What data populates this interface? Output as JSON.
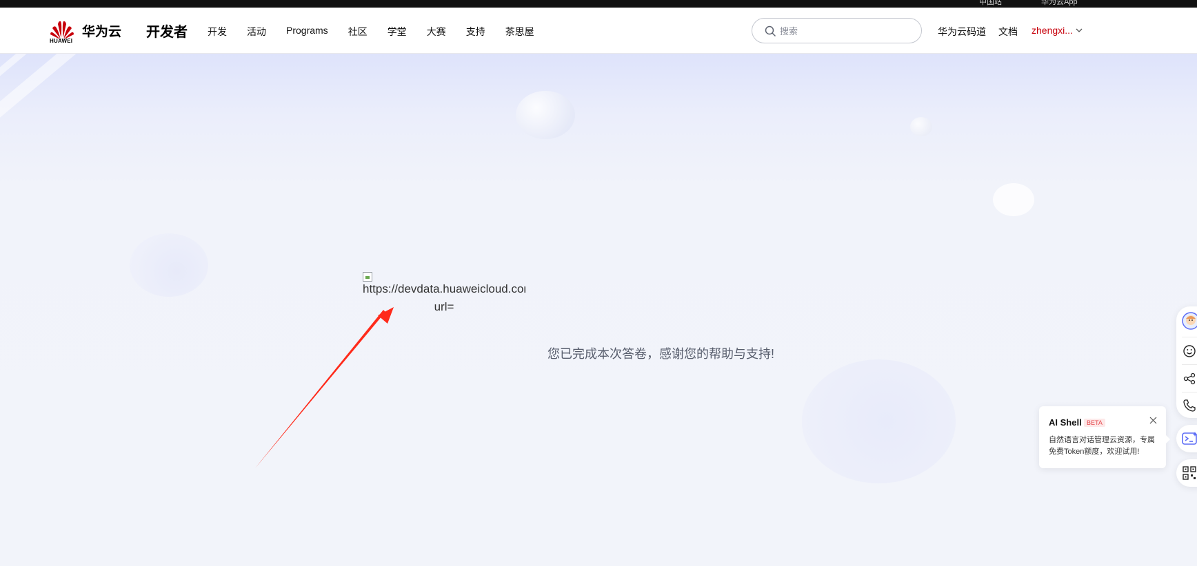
{
  "topbar": {
    "item1": "中国站",
    "item2": "华为云App"
  },
  "header": {
    "logo_word": "HUAWEI",
    "brand": "华为云",
    "section": "开发者",
    "nav": [
      "开发",
      "活动",
      "Programs",
      "社区",
      "学堂",
      "大赛",
      "支持",
      "茶思屋"
    ],
    "search_placeholder": "搜索",
    "links": [
      "华为云码道",
      "文档"
    ],
    "user": "zhengxi..."
  },
  "main": {
    "broken_image_alt_line1": "https://devdata.huaweicloud.com",
    "broken_image_alt_line2": "url=",
    "thanks_message": "您已完成本次答卷，感谢您的帮助与支持!"
  },
  "ai_shell": {
    "title": "AI Shell",
    "badge": "BETA",
    "description": "自然语言对话管理云资源，专属免费Token额度，欢迎试用!"
  },
  "colors": {
    "brand_red": "#c7000b",
    "arrow_red": "#ff2a1a",
    "ai_accent": "#5b6cf6"
  }
}
